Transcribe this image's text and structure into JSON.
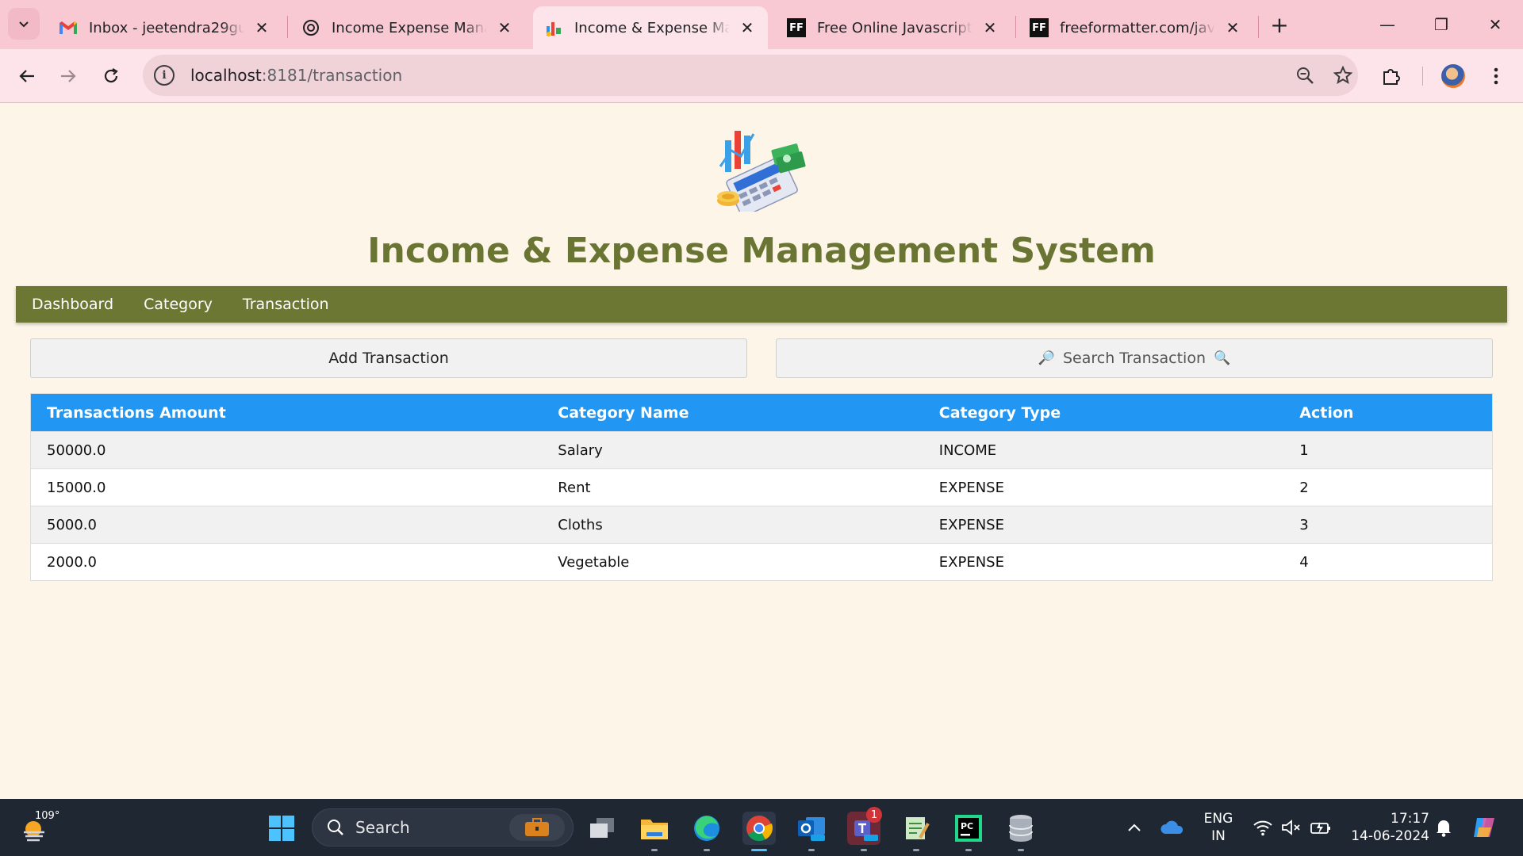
{
  "browser": {
    "tabs": [
      {
        "title": "Inbox - jeetendra29gupta",
        "icon": "gmail-icon",
        "active": false
      },
      {
        "title": "Income Expense Manager",
        "icon": "chatgpt-icon",
        "active": false
      },
      {
        "title": "Income & Expense Manager",
        "icon": "app-favicon-icon",
        "active": true
      },
      {
        "title": "Free Online Javascript Beautifier",
        "icon": "freeformatter-icon",
        "active": false
      },
      {
        "title": "freeformatter.com/javascript",
        "icon": "freeformatter-icon",
        "active": false
      }
    ],
    "freeformatter_glyph": "FF",
    "close_glyph": "✕",
    "new_tab_glyph": "+",
    "url": {
      "host": "localhost",
      "path": ":8181/transaction"
    },
    "window_controls": {
      "minimize": "—",
      "restore": "❐",
      "close": "✕"
    }
  },
  "page": {
    "title": "Income & Expense Management System",
    "nav": [
      "Dashboard",
      "Category",
      "Transaction"
    ],
    "add_button": "Add Transaction",
    "search_button": {
      "label": "Search Transaction",
      "left_glyph": "🔎",
      "right_glyph": "🔍"
    },
    "table": {
      "headers": [
        "Transactions Amount",
        "Category Name",
        "Category Type",
        "Action"
      ],
      "rows": [
        {
          "amount": "50000.0",
          "category": "Salary",
          "type": "INCOME",
          "action": "1"
        },
        {
          "amount": "15000.0",
          "category": "Rent",
          "type": "EXPENSE",
          "action": "2"
        },
        {
          "amount": "5000.0",
          "category": "Cloths",
          "type": "EXPENSE",
          "action": "3"
        },
        {
          "amount": "2000.0",
          "category": "Vegetable",
          "type": "EXPENSE",
          "action": "4"
        }
      ]
    }
  },
  "taskbar": {
    "weather_temp": "109°",
    "search_label": "Search",
    "teams_badge": "1",
    "tray": {
      "lang_top": "ENG",
      "lang_bottom": "IN",
      "time": "17:17",
      "date": "14-06-2024"
    }
  },
  "colors": {
    "title_olive": "#6b7533",
    "navbar_olive": "#6b7733",
    "table_header_blue": "#2196f3",
    "page_background": "#fdf6e8",
    "tab_strip_pink": "#f9c9d3"
  }
}
